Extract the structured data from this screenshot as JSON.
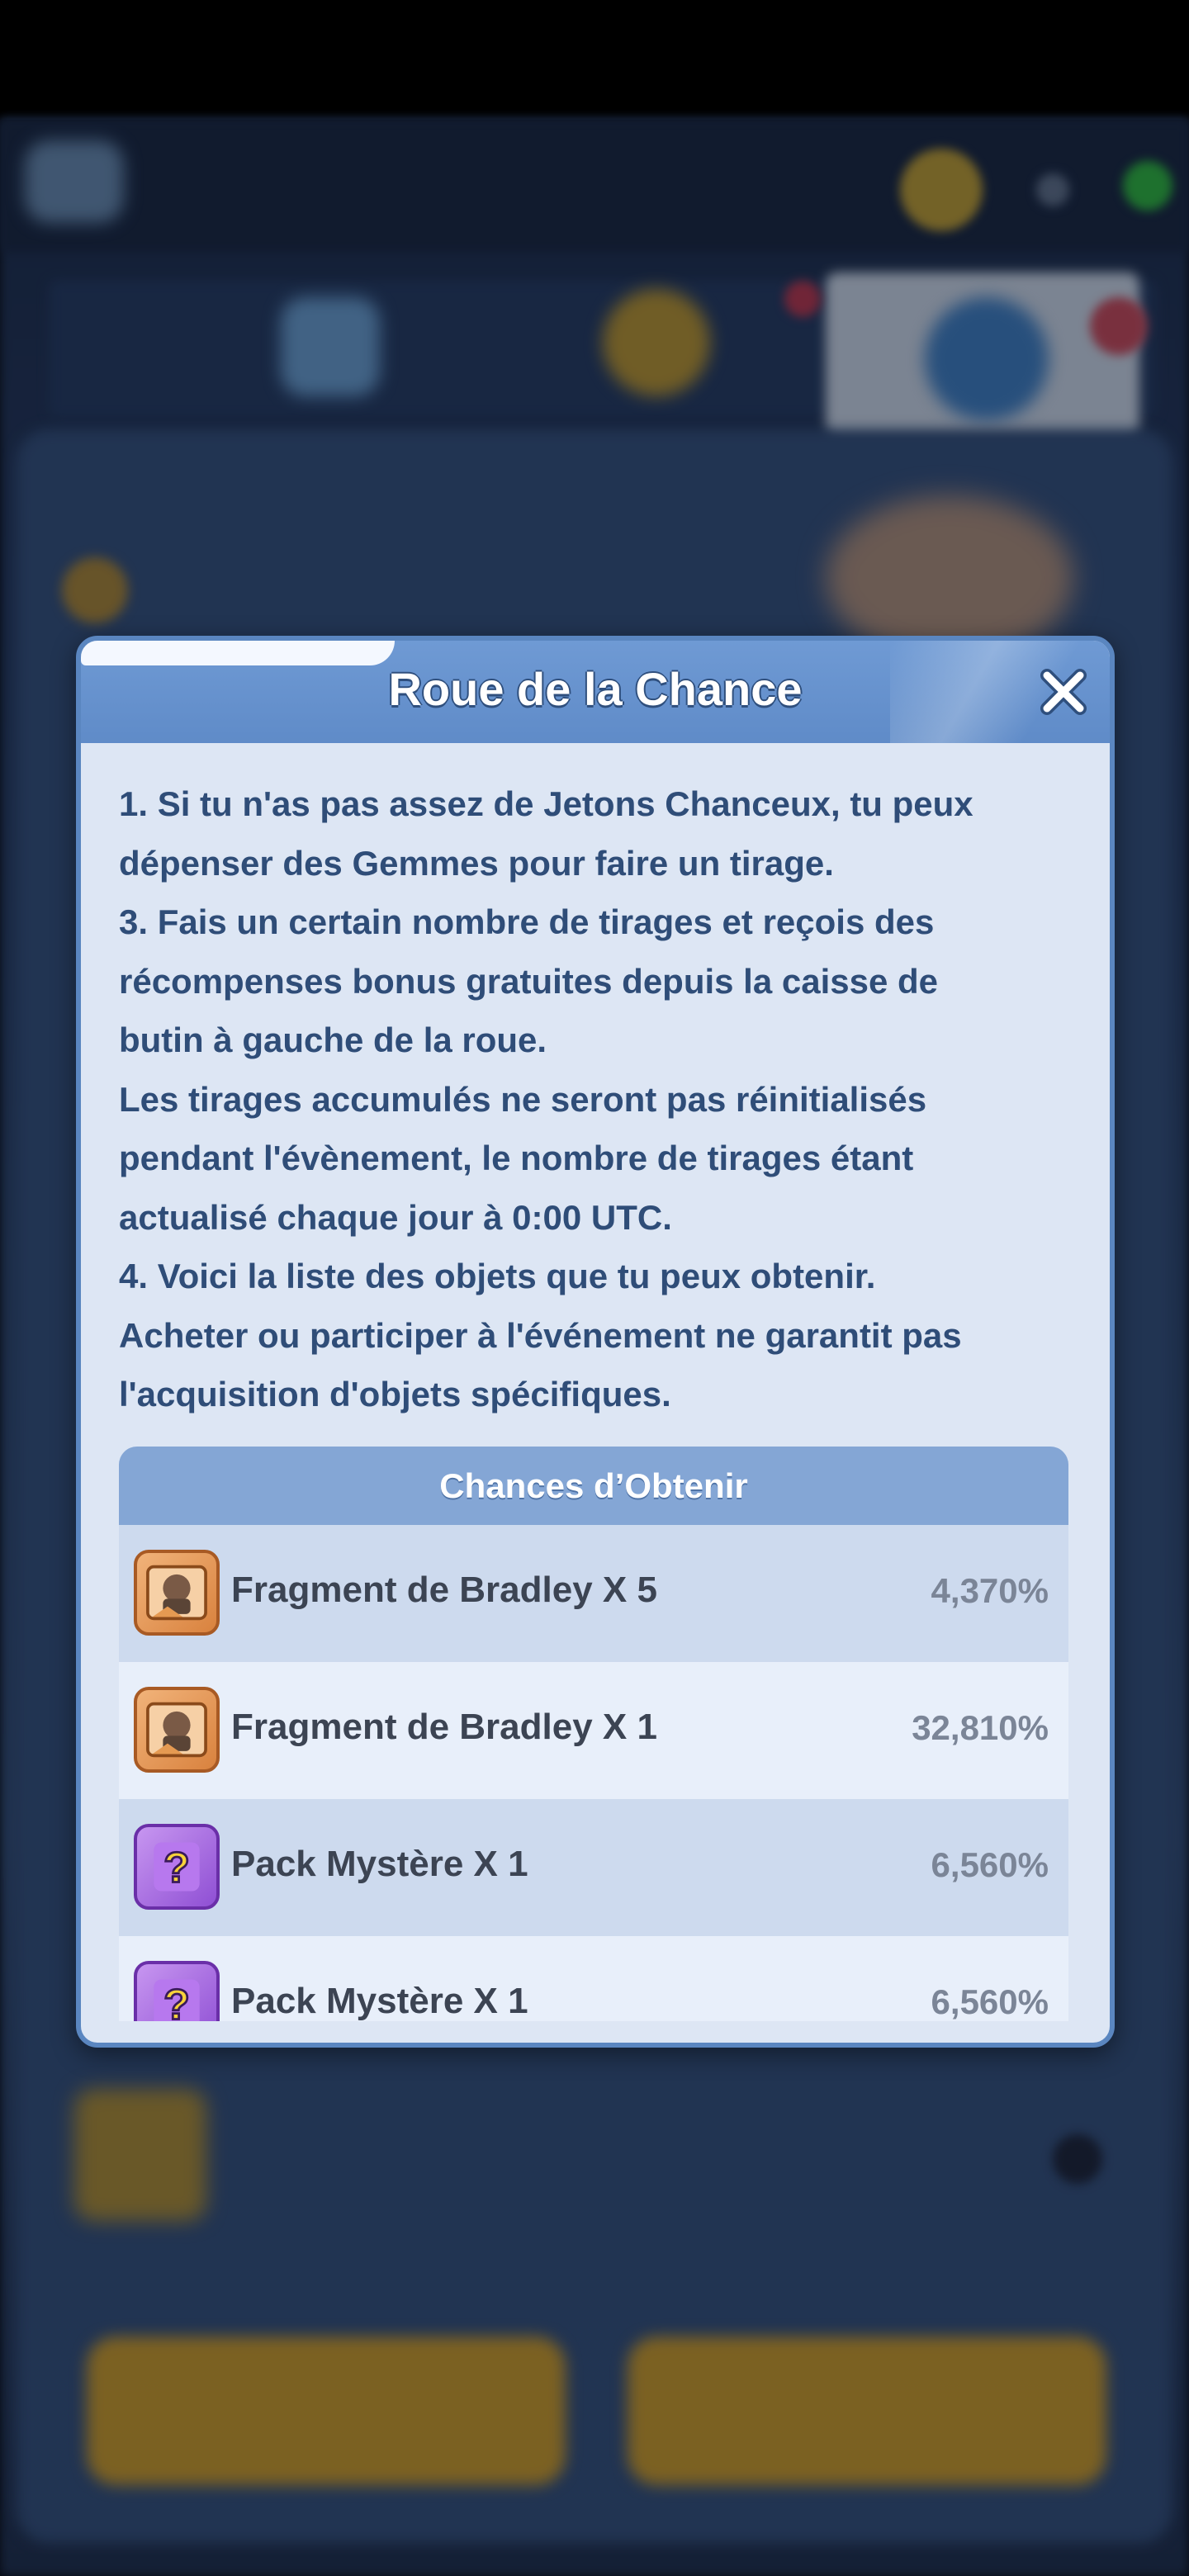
{
  "modal": {
    "title": "Roue de la Chance",
    "close_icon": "close-x-icon",
    "rules": [
      "1. Si tu n'as pas assez de Jetons Chanceux, tu peux",
      "dépenser des Gemmes pour faire un tirage.",
      "3. Fais un certain nombre de tirages et reçois des",
      "récompenses bonus gratuites depuis la caisse de",
      "butin à gauche de la roue.",
      "Les tirages accumulés ne seront pas réinitialisés",
      "pendant l'évènement, le nombre de tirages étant",
      "actualisé chaque jour à 0:00 UTC.",
      "4. Voici la liste des objets que tu peux obtenir.",
      "Acheter ou participer à l'événement ne garantit pas",
      "l'acquisition d'objets spécifiques."
    ],
    "table": {
      "header": "Chances d’Obtenir",
      "rows": [
        {
          "icon": "bradley-fragment-icon",
          "name": "Fragment de Bradley X 5",
          "chance": "4,370%"
        },
        {
          "icon": "bradley-fragment-icon",
          "name": "Fragment de Bradley X 1",
          "chance": "32,810%"
        },
        {
          "icon": "mystery-pack-icon",
          "name": "Pack Mystère X 1",
          "chance": "6,560%"
        },
        {
          "icon": "mystery-pack-icon",
          "name": "Pack Mystère X 1",
          "chance": "6,560%"
        }
      ]
    }
  },
  "colors": {
    "modal_bg": "#dde6f4",
    "header_blue": "#6f9ad4",
    "text_blue": "#2f4d78",
    "row_odd": "#cddaee",
    "row_even": "#e8effa"
  }
}
